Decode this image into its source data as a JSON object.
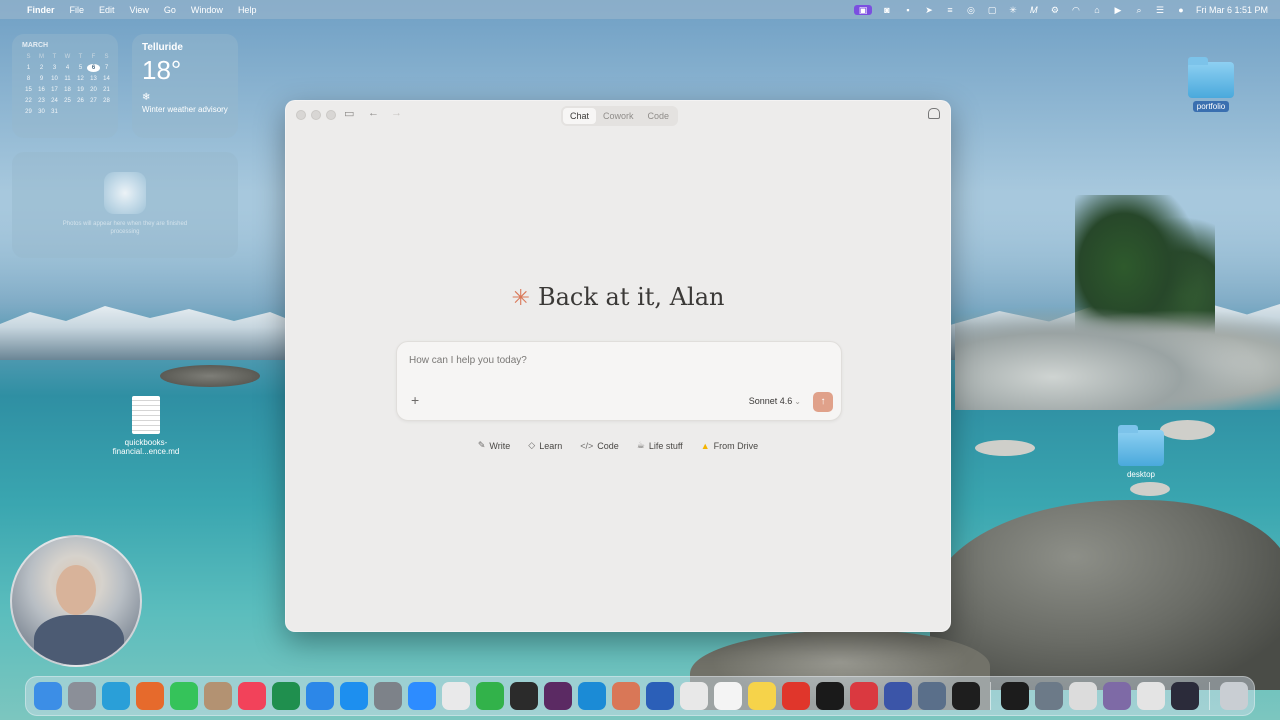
{
  "menubar": {
    "app_name": "Finder",
    "menus": [
      "File",
      "Edit",
      "View",
      "Go",
      "Window",
      "Help"
    ],
    "clock": "Fri Mar 6  1:51 PM"
  },
  "calendar": {
    "month": "MARCH",
    "weekdays": [
      "S",
      "M",
      "T",
      "W",
      "T",
      "F",
      "S"
    ],
    "days": [
      "1",
      "2",
      "3",
      "4",
      "5",
      "6",
      "7",
      "8",
      "9",
      "10",
      "11",
      "12",
      "13",
      "14",
      "15",
      "16",
      "17",
      "18",
      "19",
      "20",
      "21",
      "22",
      "23",
      "24",
      "25",
      "26",
      "27",
      "28",
      "29",
      "30",
      "31"
    ],
    "today": "6"
  },
  "weather": {
    "city": "Telluride",
    "temp": "18°",
    "note": "Winter weather advisory"
  },
  "photos_widget": {
    "text": "Photos will appear here when they are finished processing"
  },
  "desktop_icons": {
    "portfolio": "portfolio",
    "desktop": "desktop",
    "file": "quickbooks-financial...ence.md"
  },
  "window": {
    "tabs": [
      "Chat",
      "Cowork",
      "Code"
    ],
    "active_tab": "Chat",
    "greeting": "Back at it, Alan",
    "composer_placeholder": "How can I help you today?",
    "model": "Sonnet 4.6",
    "chips": [
      "Write",
      "Learn",
      "Code",
      "Life stuff",
      "From Drive"
    ]
  },
  "colors": {
    "accent": "#d97757",
    "send_button": "#e0a18a",
    "window_bg": "#edeceb"
  },
  "dock_apps": [
    {
      "icon": "finder-icon",
      "color": "#3c8ee6"
    },
    {
      "icon": "launchpad-icon",
      "color": "#8b8f98"
    },
    {
      "icon": "telegram-icon",
      "color": "#2a9fd8"
    },
    {
      "icon": "firefox-icon",
      "color": "#e66a2c"
    },
    {
      "icon": "facetime-icon",
      "color": "#35c35a"
    },
    {
      "icon": "contacts-icon",
      "color": "#b39272"
    },
    {
      "icon": "music-icon",
      "color": "#f2425a"
    },
    {
      "icon": "excel-icon",
      "color": "#1f8f4e"
    },
    {
      "icon": "safari-icon",
      "color": "#2c87e8"
    },
    {
      "icon": "app-store-icon",
      "color": "#1d8fef"
    },
    {
      "icon": "system-settings-icon",
      "color": "#7d8289"
    },
    {
      "icon": "zoom-icon",
      "color": "#2d8cff"
    },
    {
      "icon": "sheets-icon",
      "color": "#e9e9ea"
    },
    {
      "icon": "numbers-icon",
      "color": "#32b24a"
    },
    {
      "icon": "chatgpt-icon",
      "color": "#2b2b2b"
    },
    {
      "icon": "slack-icon",
      "color": "#5b2a63"
    },
    {
      "icon": "prime-video-icon",
      "color": "#1b8bd6"
    },
    {
      "icon": "claude-icon",
      "color": "#d97757"
    },
    {
      "icon": "word-icon",
      "color": "#2b5fb8"
    },
    {
      "icon": "chrome-icon",
      "color": "#e8e8e8"
    },
    {
      "icon": "textedit-icon",
      "color": "#f4f4f4"
    },
    {
      "icon": "notes-icon",
      "color": "#f6d34a"
    },
    {
      "icon": "acrobat-icon",
      "color": "#e0362b"
    },
    {
      "icon": "wunderbucket-icon",
      "color": "#1a1a1a"
    },
    {
      "icon": "expressvpn-icon",
      "color": "#da3940"
    },
    {
      "icon": "powershell-icon",
      "color": "#3b55a8"
    },
    {
      "icon": "app-icon",
      "color": "#5a6f8a"
    },
    {
      "icon": "terminal-icon",
      "color": "#1e1e1e"
    },
    {
      "icon": "window-thumb-1",
      "color": "#1c1c1c"
    },
    {
      "icon": "window-thumb-2",
      "color": "#6c7a88"
    },
    {
      "icon": "window-thumb-3",
      "color": "#dcdcdc"
    },
    {
      "icon": "window-thumb-4",
      "color": "#7e6aa6"
    },
    {
      "icon": "window-thumb-5",
      "color": "#e4e4e4"
    },
    {
      "icon": "window-thumb-6",
      "color": "#2b2b3a"
    },
    {
      "icon": "trash-icon",
      "color": "#c9ced3"
    }
  ]
}
